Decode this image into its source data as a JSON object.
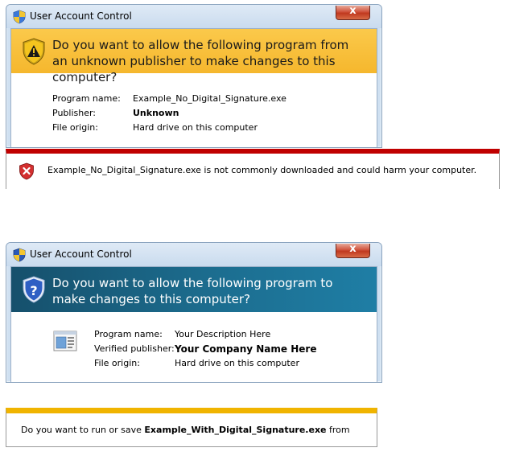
{
  "dialog_unknown": {
    "title": "User Account Control",
    "close_label": "x",
    "banner_text": "Do you want to allow the following program from an unknown publisher to make changes to this computer?",
    "banner_color": "#f5b72d",
    "program_name_label": "Program name:",
    "program_name": "Example_No_Digital_Signature.exe",
    "publisher_label": "Publisher:",
    "publisher": "Unknown",
    "file_origin_label": "File origin:",
    "file_origin": "Hard drive on this computer"
  },
  "smartscreen_warning": {
    "message": "Example_No_Digital_Signature.exe is not commonly downloaded and could harm your computer.",
    "accent_color": "#c00000"
  },
  "dialog_verified": {
    "title": "User Account Control",
    "close_label": "x",
    "banner_text": "Do you want to allow the following program to make changes to this computer?",
    "banner_color": "#1c6d8f",
    "program_name_label": "Program name:",
    "program_name": "Your Description Here",
    "publisher_label": "Verified publisher:",
    "publisher": "Your Company Name Here",
    "file_origin_label": "File origin:",
    "file_origin": "Hard drive on this computer"
  },
  "download_bar": {
    "prefix": "Do you want to run or save ",
    "file_name": "Example_With_Digital_Signature.exe",
    "suffix": " from",
    "accent_color": "#f0b400"
  }
}
